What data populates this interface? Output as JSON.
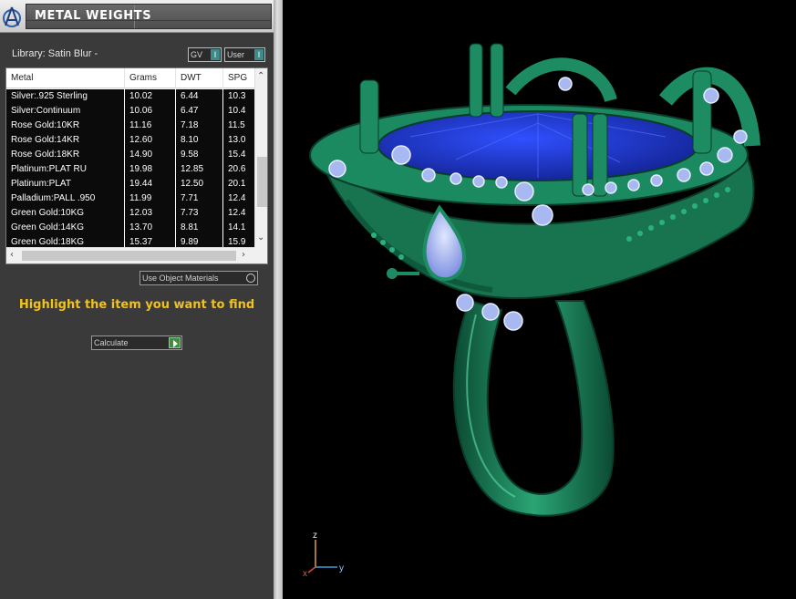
{
  "panel": {
    "title": "METAL WEIGHTS",
    "library_label": "Library: Satin Blur -",
    "gv_toggle": "GV",
    "user_toggle": "User",
    "toggle_indicator": "I"
  },
  "table": {
    "columns": [
      "Metal",
      "Grams",
      "DWT",
      "SPG"
    ],
    "rows": [
      [
        "Silver:.925 Sterling",
        "10.02",
        "6.44",
        "10.3"
      ],
      [
        "Silver:Continuum",
        "10.06",
        "6.47",
        "10.4"
      ],
      [
        "Rose Gold:10KR",
        "11.16",
        "7.18",
        "11.5"
      ],
      [
        "Rose Gold:14KR",
        "12.60",
        "8.10",
        "13.0"
      ],
      [
        "Rose Gold:18KR",
        "14.90",
        "9.58",
        "15.4"
      ],
      [
        "Platinum:PLAT RU",
        "19.98",
        "12.85",
        "20.6"
      ],
      [
        "Platinum:PLAT",
        "19.44",
        "12.50",
        "20.1"
      ],
      [
        "Palladium:PALL .950",
        "11.99",
        "7.71",
        "12.4"
      ],
      [
        "Green Gold:10KG",
        "12.03",
        "7.73",
        "12.4"
      ],
      [
        "Green Gold:14KG",
        "13.70",
        "8.81",
        "14.1"
      ],
      [
        "Green Gold:18KG",
        "15.37",
        "9.89",
        "15.9"
      ]
    ]
  },
  "controls": {
    "use_object_materials": "Use Object Materials",
    "hint": "Highlight the item you want to find",
    "calculate": "Calculate"
  },
  "viewport": {
    "axis_z": "z",
    "axis_y": "y",
    "axis_x": "x",
    "model_color": "#1e8c63",
    "stone_color": "#1c3bd6",
    "diamond_color": "#a8b8f0"
  }
}
